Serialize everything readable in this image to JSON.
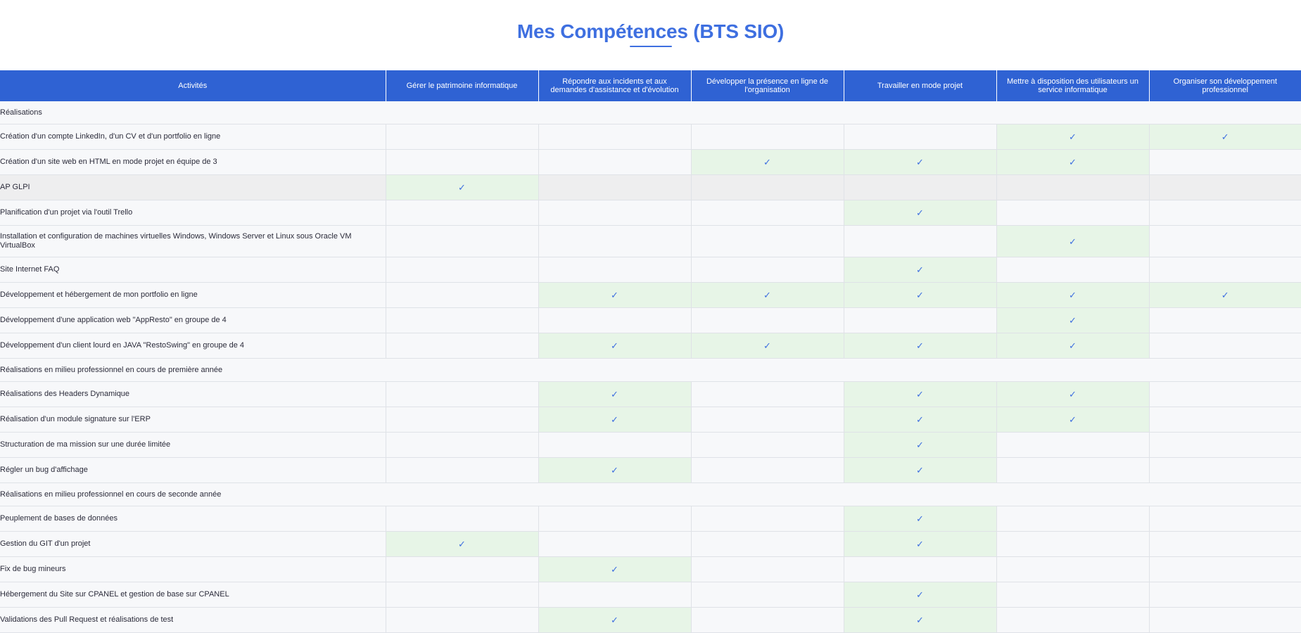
{
  "page": {
    "title": "Mes Compétences (BTS SIO)"
  },
  "table": {
    "headers": [
      "Activités",
      "Gérer le patrimoine informatique",
      "Répondre aux incidents et aux demandes d'assistance et d'évolution",
      "Développer la présence en ligne de l'organisation",
      "Travailler en mode projet",
      "Mettre à disposition des utilisateurs un service informatique",
      "Organiser son développement professionnel"
    ],
    "check_symbol": "✓",
    "colors": {
      "header_bg": "#2f62d3",
      "title": "#3e6fe0",
      "check_cell_bg": "#e7f5e7",
      "check": "#3e6fe0"
    },
    "rows": [
      {
        "type": "section",
        "label": "Réalisations"
      },
      {
        "type": "item",
        "label": "Création d'un compte LinkedIn, d'un CV et d'un portfolio en ligne",
        "checks": [
          false,
          false,
          false,
          false,
          true,
          true
        ]
      },
      {
        "type": "item",
        "label": "Création d'un site web en HTML en mode projet en équipe de 3",
        "checks": [
          false,
          false,
          true,
          true,
          true,
          false
        ]
      },
      {
        "type": "item",
        "label": "AP GLPI",
        "highlight": true,
        "checks": [
          true,
          false,
          false,
          false,
          false,
          false
        ]
      },
      {
        "type": "item",
        "label": "Planification d'un projet via l'outil Trello",
        "checks": [
          false,
          false,
          false,
          true,
          false,
          false
        ]
      },
      {
        "type": "item",
        "label": "Installation et configuration de machines virtuelles Windows, Windows Server et Linux sous Oracle VM VirtualBox",
        "tall": true,
        "checks": [
          false,
          false,
          false,
          false,
          true,
          false
        ]
      },
      {
        "type": "item",
        "label": "Site Internet FAQ",
        "checks": [
          false,
          false,
          false,
          true,
          false,
          false
        ]
      },
      {
        "type": "item",
        "label": "Développement et hébergement de mon portfolio en ligne",
        "checks": [
          false,
          true,
          true,
          true,
          true,
          true
        ]
      },
      {
        "type": "item",
        "label": "Développement d'une application web \"AppResto\" en groupe de 4",
        "checks": [
          false,
          false,
          false,
          false,
          true,
          false
        ]
      },
      {
        "type": "item",
        "label": "Développement d'un client lourd en JAVA \"RestoSwing\" en groupe de 4",
        "checks": [
          false,
          true,
          true,
          true,
          true,
          false
        ]
      },
      {
        "type": "section",
        "label": "Réalisations en milieu professionnel en cours de première année"
      },
      {
        "type": "item",
        "label": "Réalisations des Headers Dynamique",
        "checks": [
          false,
          true,
          false,
          true,
          true,
          false
        ]
      },
      {
        "type": "item",
        "label": "Réalisation d'un module signature sur l'ERP",
        "checks": [
          false,
          true,
          false,
          true,
          true,
          false
        ]
      },
      {
        "type": "item",
        "label": "Structuration de ma mission sur une durée limitée",
        "checks": [
          false,
          false,
          false,
          true,
          false,
          false
        ]
      },
      {
        "type": "item",
        "label": "Régler un bug d'affichage",
        "checks": [
          false,
          true,
          false,
          true,
          false,
          false
        ]
      },
      {
        "type": "section",
        "label": "Réalisations en milieu professionnel en cours de seconde année"
      },
      {
        "type": "item",
        "label": "Peuplement de bases de données",
        "checks": [
          false,
          false,
          false,
          true,
          false,
          false
        ]
      },
      {
        "type": "item",
        "label": "Gestion du GIT d'un projet",
        "checks": [
          true,
          false,
          false,
          true,
          false,
          false
        ]
      },
      {
        "type": "item",
        "label": "Fix de bug mineurs",
        "checks": [
          false,
          true,
          false,
          false,
          false,
          false
        ]
      },
      {
        "type": "item",
        "label": "Hébergement du Site sur CPANEL et gestion de base sur CPANEL",
        "checks": [
          false,
          false,
          false,
          true,
          false,
          false
        ]
      },
      {
        "type": "item",
        "label": "Validations des Pull Request et réalisations de test",
        "checks": [
          false,
          true,
          false,
          true,
          false,
          false
        ]
      }
    ]
  }
}
